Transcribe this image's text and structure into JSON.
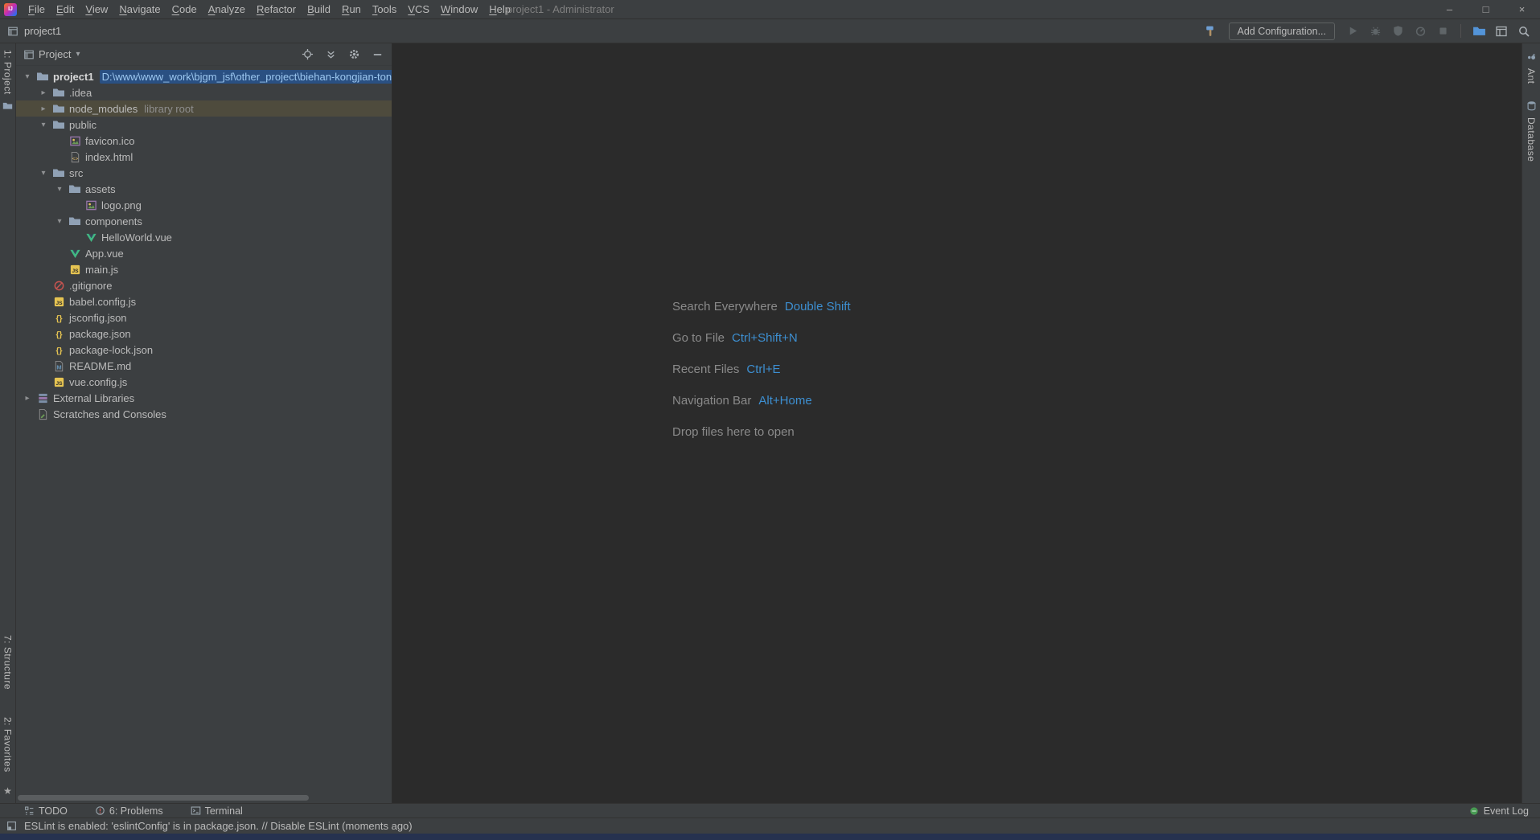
{
  "colors": {
    "panel_bg": "#3c3f41",
    "editor_bg": "#2b2b2b",
    "border": "#323232",
    "text": "#bbbbbb",
    "accent_blue": "#3d8fd1",
    "path_highlight_bg": "#2a5082",
    "path_highlight_text": "#9cc7f0",
    "library_row_bg": "#4e4b3d",
    "event_log_green": "#499c54",
    "vue_green": "#41b883",
    "js_yellow": "#e6c452"
  },
  "title_bar": {
    "menu_items": [
      "File",
      "Edit",
      "View",
      "Navigate",
      "Code",
      "Analyze",
      "Refactor",
      "Build",
      "Run",
      "Tools",
      "VCS",
      "Window",
      "Help"
    ],
    "window_title": "project1 - Administrator",
    "window_controls": [
      "minimize",
      "maximize",
      "close"
    ]
  },
  "toolbar": {
    "project_name": "project1",
    "add_configuration_label": "Add Configuration...",
    "run_icons": [
      "run",
      "debug",
      "coverage",
      "profiler",
      "stop"
    ],
    "end_icons": [
      "open-project",
      "restore-layout",
      "search-everywhere"
    ]
  },
  "left_strip": {
    "top": [
      {
        "icon": "project-folder",
        "label": "1: Project"
      }
    ],
    "bottom": [
      "7: Structure",
      "2: Favorites"
    ]
  },
  "right_strip": {
    "tabs": [
      {
        "icon": "ant",
        "label": "Ant"
      },
      {
        "icon": "database",
        "label": "Database"
      }
    ]
  },
  "project_panel": {
    "header": {
      "title": "Project"
    },
    "tree": [
      {
        "label": "project1",
        "path": "D:\\www\\www_work\\bjgm_jsf\\other_project\\biehan-kongjian-ton",
        "level": 0,
        "chevron": "v",
        "icon": "folder",
        "bold": true
      },
      {
        "label": ".idea",
        "level": 1,
        "chevron": ">",
        "icon": "folder"
      },
      {
        "label": "node_modules",
        "badge": "library root",
        "level": 1,
        "chevron": ">",
        "icon": "folder",
        "row_highlight": true
      },
      {
        "label": "public",
        "level": 1,
        "chevron": "v",
        "icon": "folder"
      },
      {
        "label": "favicon.ico",
        "level": 2,
        "icon": "image"
      },
      {
        "label": "index.html",
        "level": 2,
        "icon": "html"
      },
      {
        "label": "src",
        "level": 1,
        "chevron": "v",
        "icon": "folder"
      },
      {
        "label": "assets",
        "level": 2,
        "chevron": "v",
        "icon": "folder"
      },
      {
        "label": "logo.png",
        "level": 3,
        "icon": "image"
      },
      {
        "label": "components",
        "level": 2,
        "chevron": "v",
        "icon": "folder"
      },
      {
        "label": "HelloWorld.vue",
        "level": 3,
        "icon": "vue"
      },
      {
        "label": "App.vue",
        "level": 2,
        "icon": "vue"
      },
      {
        "label": "main.js",
        "level": 2,
        "icon": "js"
      },
      {
        "label": ".gitignore",
        "level": 1,
        "icon": "ignore"
      },
      {
        "label": "babel.config.js",
        "level": 1,
        "icon": "js"
      },
      {
        "label": "jsconfig.json",
        "level": 1,
        "icon": "json"
      },
      {
        "label": "package.json",
        "level": 1,
        "icon": "json"
      },
      {
        "label": "package-lock.json",
        "level": 1,
        "icon": "json"
      },
      {
        "label": "README.md",
        "level": 1,
        "icon": "md"
      },
      {
        "label": "vue.config.js",
        "level": 1,
        "icon": "js"
      },
      {
        "label": "External Libraries",
        "level": 0,
        "chevron": ">",
        "icon": "library"
      },
      {
        "label": "Scratches and Consoles",
        "level": 0,
        "icon": "scratch"
      }
    ]
  },
  "editor": {
    "shortcuts": [
      {
        "action": "Search Everywhere",
        "keys": "Double Shift"
      },
      {
        "action": "Go to File",
        "keys": "Ctrl+Shift+N"
      },
      {
        "action": "Recent Files",
        "keys": "Ctrl+E"
      },
      {
        "action": "Navigation Bar",
        "keys": "Alt+Home"
      },
      {
        "action": "Drop files here to open",
        "keys": ""
      }
    ]
  },
  "bottom_bar": {
    "tabs": [
      {
        "icon": "todo",
        "label": "TODO"
      },
      {
        "icon": "problems",
        "label": "6: Problems"
      },
      {
        "icon": "terminal",
        "label": "Terminal"
      }
    ],
    "event_log_label": "Event Log"
  },
  "status_bar": {
    "message": "ESLint is enabled: 'eslintConfig' is in package.json. // Disable ESLint (moments ago)"
  }
}
